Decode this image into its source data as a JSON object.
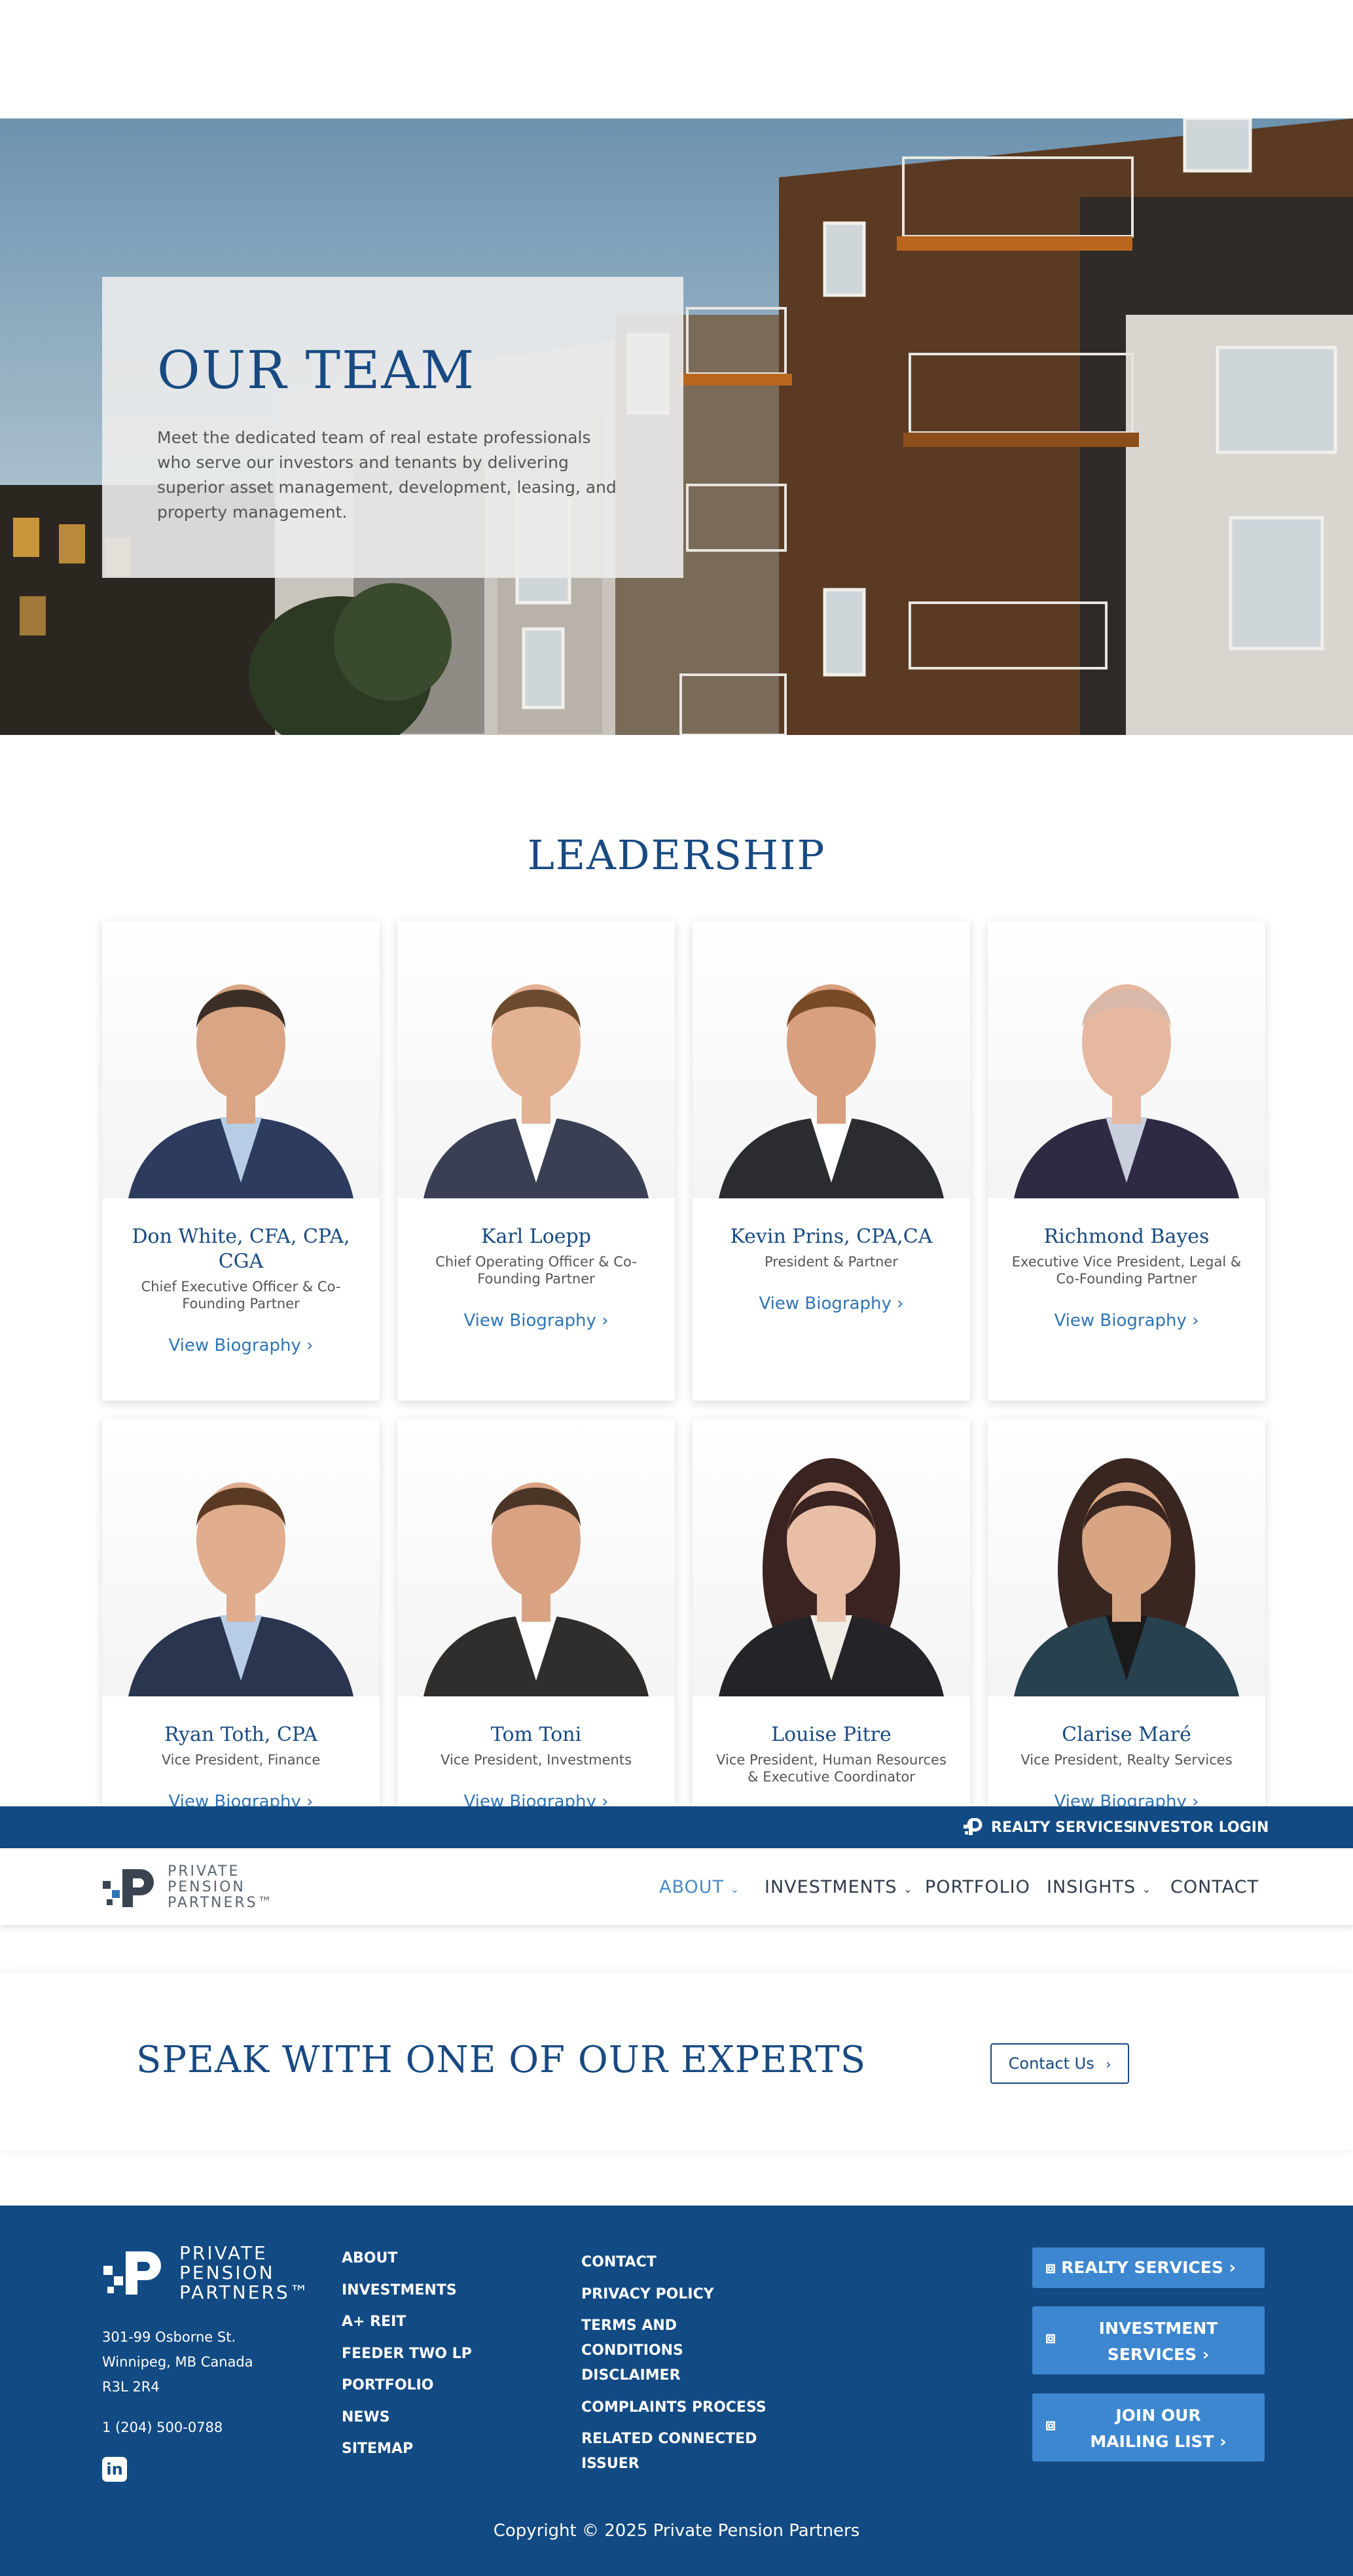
{
  "hero": {
    "title": "OUR TEAM",
    "description": "Meet the dedicated team of real estate professionals who serve our investors and tenants by delivering superior asset management, development, leasing, and property management."
  },
  "leadership": {
    "title": "LEADERSHIP",
    "bio_label": "View Biography",
    "members": [
      {
        "name": "Don White, CFA, CPA, CGA",
        "role": "Chief Executive Officer & Co-Founding Partner"
      },
      {
        "name": "Karl Loepp",
        "role": "Chief Operating Officer & Co-Founding Partner"
      },
      {
        "name": "Kevin Prins, CPA,CA",
        "role": "President & Partner"
      },
      {
        "name": "Richmond Bayes",
        "role": "Executive Vice President, Legal & Co-Founding Partner"
      },
      {
        "name": "Ryan Toth, CPA",
        "role": "Vice President, Finance"
      },
      {
        "name": "Tom Toni",
        "role": "Vice President, Investments"
      },
      {
        "name": "Louise Pitre",
        "role": "Vice President, Human Resources & Executive Coordinator"
      },
      {
        "name": "Clarise Maré",
        "role": "Vice President, Realty Services"
      }
    ]
  },
  "topbar": {
    "realty": "REALTY SERVICES",
    "investor_login": "INVESTOR LOGIN"
  },
  "nav": {
    "logo_lines": [
      "PRIVATE",
      "PENSION",
      "PARTNERS™"
    ],
    "items": [
      "ABOUT",
      "INVESTMENTS",
      "PORTFOLIO",
      "INSIGHTS",
      "CONTACT"
    ]
  },
  "cta": {
    "title": "SPEAK WITH ONE OF OUR EXPERTS",
    "button": "Contact Us"
  },
  "footer": {
    "logo_lines": [
      "PRIVATE",
      "PENSION",
      "PARTNERS™"
    ],
    "address": [
      "301-99 Osborne St.",
      "Winnipeg, MB Canada",
      "R3L 2R4"
    ],
    "phone": "1 (204) 500-0788",
    "col1": [
      "ABOUT",
      "INVESTMENTS",
      "A+ REIT",
      "FEEDER TWO LP",
      "PORTFOLIO",
      "NEWS",
      "SITEMAP"
    ],
    "col2": [
      "CONTACT",
      "PRIVACY POLICY",
      "TERMS AND CONDITIONS",
      "DISCLAIMER",
      "COMPLAINTS PROCESS",
      "RELATED CONNECTED ISSUER"
    ],
    "buttons": [
      "REALTY SERVICES",
      "INVESTMENT SERVICES",
      "JOIN OUR MAILING LIST"
    ],
    "copyright": "Copyright © 2025 Private Pension Partners"
  },
  "colors": {
    "brand_navy": "#124a83",
    "heading_blue": "#184a82",
    "link_blue": "#2f74b5",
    "button_blue": "#3d87d0"
  }
}
